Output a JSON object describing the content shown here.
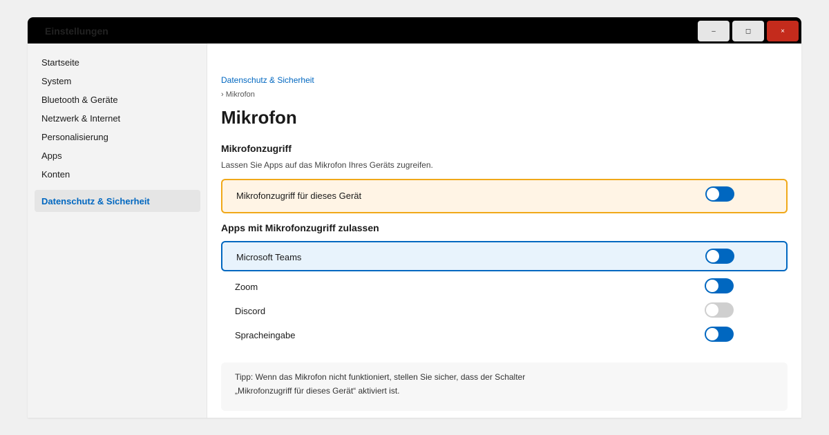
{
  "window": {
    "title": "Einstellungen",
    "controls": {
      "minimize": "–",
      "maximize": "◻",
      "close": "×"
    },
    "close_color": "#c42b1c"
  },
  "sidebar": {
    "items": [
      {
        "label": "Startseite"
      },
      {
        "label": "System"
      },
      {
        "label": "Bluetooth & Geräte"
      },
      {
        "label": "Netzwerk & Internet"
      },
      {
        "label": "Personalisierung"
      },
      {
        "label": "Apps"
      },
      {
        "label": "Konten"
      }
    ],
    "active_item": "Datenschutz & Sicherheit",
    "accent_color": "#0067c0"
  },
  "breadcrumb": {
    "parent": "Datenschutz & Sicherheit",
    "current": "› Mikrofon"
  },
  "page": {
    "title": "Mikrofon"
  },
  "access_section": {
    "title": "Mikrofonzugriff",
    "description": "Lassen Sie Apps auf das Mikrofon Ihres Geräts zugreifen.",
    "device_toggle": {
      "label": "Mikrofonzugriff für dieses Gerät",
      "on": true
    }
  },
  "apps_section": {
    "title": "Apps mit Mikrofonzugriff zulassen",
    "apps": [
      {
        "name": "Microsoft Teams",
        "on": true,
        "selected": true
      },
      {
        "name": "Zoom",
        "on": true,
        "selected": false
      },
      {
        "name": "Discord",
        "on": false,
        "selected": false
      },
      {
        "name": "Spracheingabe",
        "on": true,
        "selected": false
      }
    ]
  },
  "tip": {
    "line1": "Tipp: Wenn das Mikrofon nicht funktioniert, stellen Sie sicher, dass der Schalter",
    "line2": "„Mikrofonzugriff für dieses Gerät“ aktiviert ist."
  }
}
